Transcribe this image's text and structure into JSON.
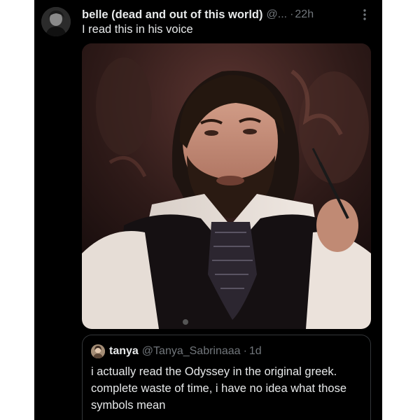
{
  "tweet": {
    "display_name": "belle (dead and out of this world)",
    "handle": "@...",
    "separator": "·",
    "time": "22h",
    "text": "I read this in his voice"
  },
  "quoted_tweet": {
    "display_name": "tanya",
    "handle": "@Tanya_Sabrinaaa",
    "separator": "·",
    "time": "1d",
    "text": "i actually read the Odyssey in the original greek. complete waste of time, i have no idea what those symbols mean"
  },
  "icons": {
    "more": "more-vertical-icon",
    "avatar": "profile-avatar",
    "media": "photo-of-man-with-long-hair-beard-and-cravat"
  },
  "colors": {
    "background": "#000000",
    "primary_text": "#e7e9ea",
    "secondary_text": "#71767b",
    "border": "#333639"
  }
}
